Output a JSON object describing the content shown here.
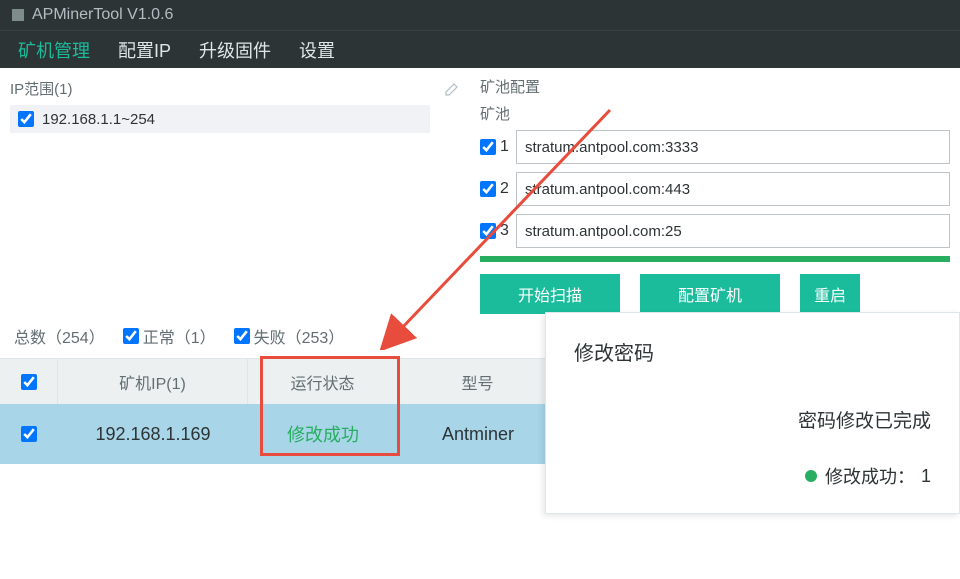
{
  "titlebar": {
    "title": "APMinerTool V1.0.6"
  },
  "menubar": {
    "items": [
      {
        "label": "矿机管理",
        "active": true
      },
      {
        "label": "配置IP",
        "active": false
      },
      {
        "label": "升级固件",
        "active": false
      },
      {
        "label": "设置",
        "active": false
      }
    ]
  },
  "ip_range": {
    "label": "IP范围(1)",
    "value": "192.168.1.1~254"
  },
  "pool_config": {
    "label": "矿池配置",
    "sublabel": "矿池",
    "pools": [
      {
        "num": "1",
        "value": "stratum.antpool.com:3333"
      },
      {
        "num": "2",
        "value": "stratum.antpool.com:443"
      },
      {
        "num": "3",
        "value": "stratum.antpool.com:25"
      }
    ]
  },
  "buttons": {
    "scan": "开始扫描",
    "config": "配置矿机",
    "restart": "重启"
  },
  "stats": {
    "total": "总数（254）",
    "normal": "正常（1）",
    "failed": "失败（253）"
  },
  "table": {
    "headers": {
      "ip": "矿机IP(1)",
      "status": "运行状态",
      "model": "型号"
    },
    "row": {
      "ip": "192.168.1.169",
      "status": "修改成功",
      "model": "Antminer"
    }
  },
  "popup": {
    "title": "修改密码",
    "body": "密码修改已完成",
    "status_label": "修改成功：",
    "status_count": "1"
  }
}
